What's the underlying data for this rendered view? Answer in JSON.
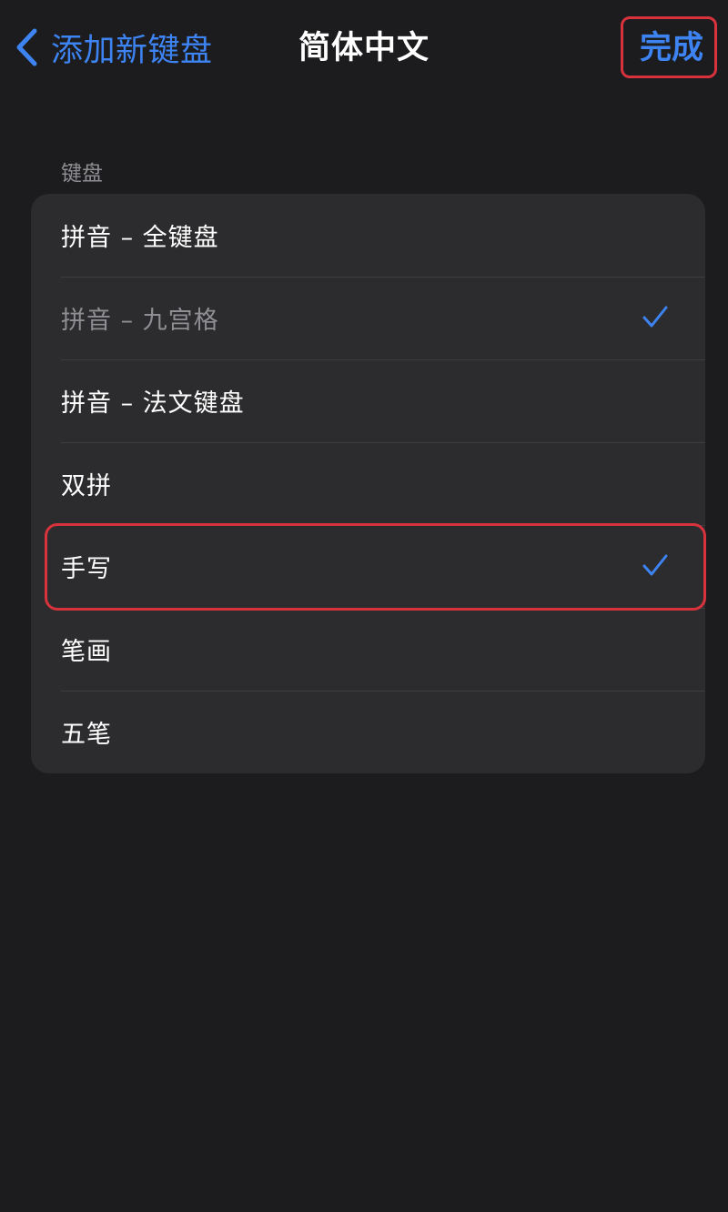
{
  "navbar": {
    "back_label": "添加新键盘",
    "title": "简体中文",
    "done_label": "完成"
  },
  "section": {
    "header": "键盘"
  },
  "keyboards": [
    {
      "label": "拼音 – 全键盘",
      "checked": false,
      "enabled": true
    },
    {
      "label": "拼音 – 九宫格",
      "checked": true,
      "enabled": false
    },
    {
      "label": "拼音 – 法文键盘",
      "checked": false,
      "enabled": true
    },
    {
      "label": "双拼",
      "checked": false,
      "enabled": true
    },
    {
      "label": "手写",
      "checked": true,
      "enabled": true
    },
    {
      "label": "笔画",
      "checked": false,
      "enabled": true
    },
    {
      "label": "五笔",
      "checked": false,
      "enabled": true
    }
  ],
  "colors": {
    "accent": "#3d83f2",
    "background": "#1c1c1e",
    "cell": "#2c2c2e",
    "highlight": "#d8333d",
    "secondary_text": "#8e8e93"
  },
  "icons": {
    "back": "chevron-left-icon",
    "check": "checkmark-icon"
  }
}
